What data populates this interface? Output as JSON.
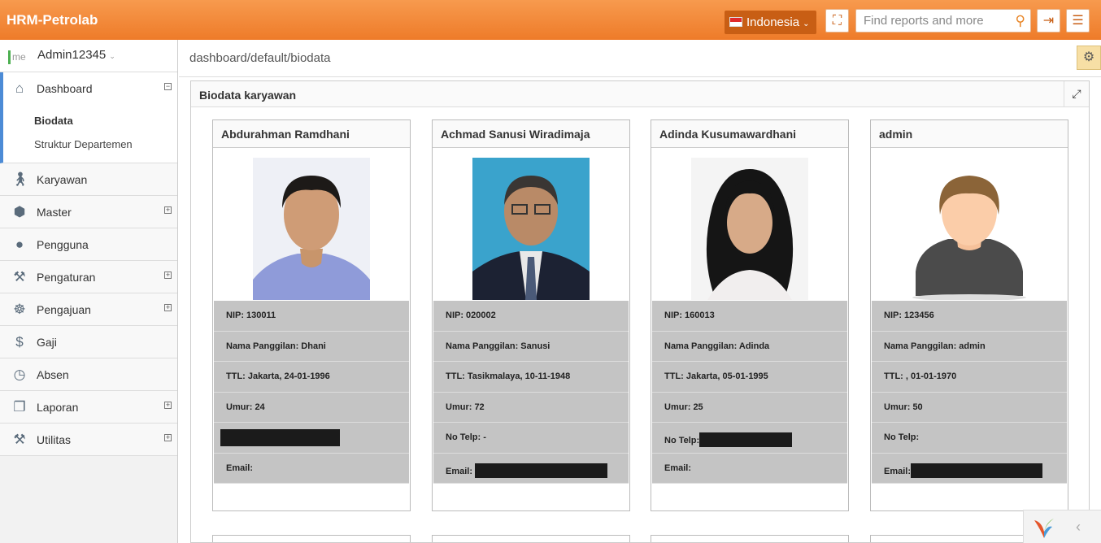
{
  "app": {
    "title": "HRM-Petrolab"
  },
  "topbar": {
    "language": "Indonesia",
    "search_placeholder": "Find reports and more"
  },
  "user": {
    "me_label": "me",
    "name": "Admin12345"
  },
  "sidebar": {
    "dashboard": {
      "label": "Dashboard",
      "sub": [
        "Biodata",
        "Struktur Departemen"
      ]
    },
    "items": [
      {
        "label": "Karyawan",
        "icon": "person-icon"
      },
      {
        "label": "Master",
        "icon": "cube-icon"
      },
      {
        "label": "Pengguna",
        "icon": "user-icon"
      },
      {
        "label": "Pengaturan",
        "icon": "wrench-icon"
      },
      {
        "label": "Pengajuan",
        "icon": "dharma-icon"
      },
      {
        "label": "Gaji",
        "icon": "dollar-icon"
      },
      {
        "label": "Absen",
        "icon": "clock-icon"
      },
      {
        "label": "Laporan",
        "icon": "copy-icon"
      },
      {
        "label": "Utilitas",
        "icon": "wrench-icon"
      }
    ]
  },
  "breadcrumb": "dashboard/default/biodata",
  "panel": {
    "title": "Biodata karyawan"
  },
  "cards": [
    {
      "name": "Abdurahman Ramdhani",
      "nip": "NIP: 130011",
      "panggilan": "Nama Panggilan: Dhani",
      "ttl": "TTL: Jakarta, 24-01-1996",
      "umur": "Umur: 24",
      "telp": "",
      "email": "Email:"
    },
    {
      "name": "Achmad Sanusi Wiradimaja",
      "nip": "NIP: 020002",
      "panggilan": "Nama Panggilan: Sanusi",
      "ttl": "TTL: Tasikmalaya, 10-11-1948",
      "umur": "Umur: 72",
      "telp": "No Telp: -",
      "email": "Email:"
    },
    {
      "name": "Adinda Kusumawardhani",
      "nip": "NIP: 160013",
      "panggilan": "Nama Panggilan: Adinda",
      "ttl": "TTL: Jakarta, 05-01-1995",
      "umur": "Umur: 25",
      "telp": "No Telp:",
      "email": "Email:"
    },
    {
      "name": "admin",
      "nip": "NIP: 123456",
      "panggilan": "Nama Panggilan: admin",
      "ttl": "TTL: , 01-01-1970",
      "umur": "Umur: 50",
      "telp": "No Telp:",
      "email": "Email:"
    }
  ]
}
